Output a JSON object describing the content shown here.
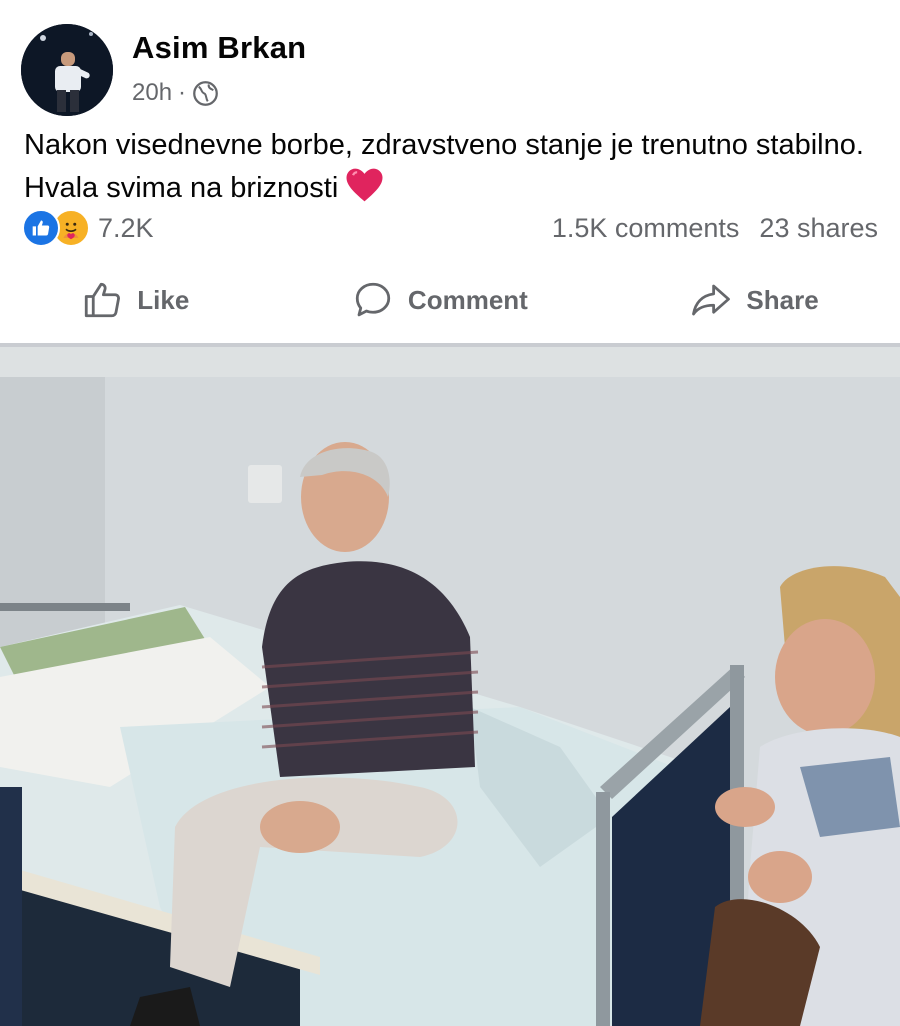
{
  "post": {
    "author": "Asim Brkan",
    "time": "20h",
    "separator": "·",
    "privacy_icon": "globe-icon",
    "text": "Nakon visednevne borbe, zdravstveno stanje je trenutno stabilno. Hvala svima na briznosti",
    "emoji_icon": "red-heart-icon"
  },
  "reactions": {
    "icons": [
      "like-reaction-icon",
      "care-reaction-icon"
    ],
    "count": "7.2K",
    "comments": "1.5K comments",
    "shares": "23 shares"
  },
  "actions": {
    "like": "Like",
    "comment": "Comment",
    "share": "Share"
  },
  "colors": {
    "text_primary": "#050505",
    "text_secondary": "#65676b",
    "like_blue": "#1b74e4",
    "heart_red": "#e0245e",
    "divider": "#c9ccd1"
  }
}
